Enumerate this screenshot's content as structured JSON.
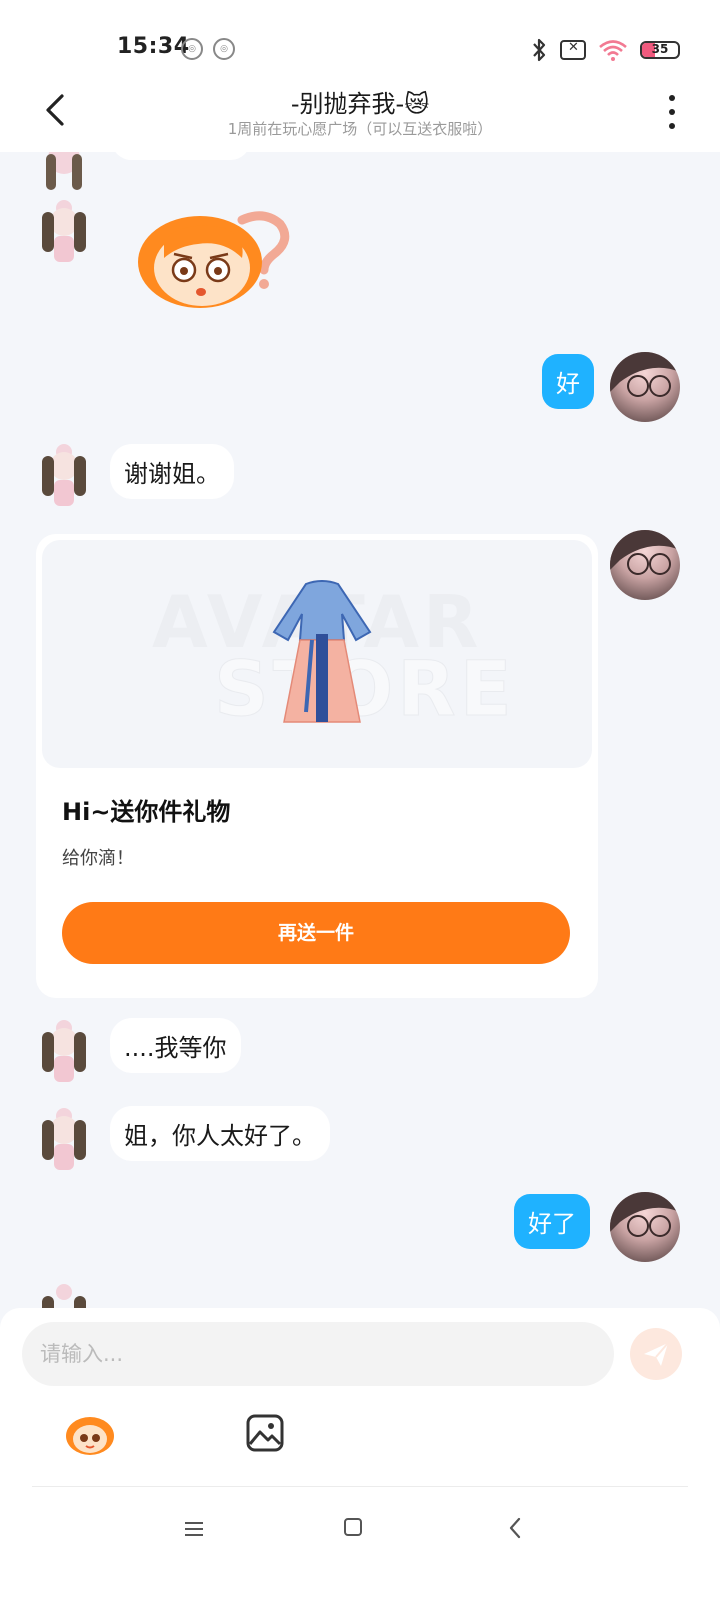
{
  "status_bar": {
    "time": "15:34",
    "notif_icon_1": "notification-icon",
    "notif_icon_2": "notification-icon",
    "battery_level": "35",
    "icons": [
      "bluetooth-icon",
      "no-sim-icon",
      "wifi-icon",
      "battery-icon"
    ],
    "battery_color": "#f05a7e"
  },
  "header": {
    "title": "-别抛弃我-",
    "title_emoji": "😿",
    "subtitle": "1周前在玩心愿广场（可以互送衣服啦）"
  },
  "messages": [
    {
      "side": "left",
      "type": "sticker",
      "sticker": "question-mark-sticker"
    },
    {
      "side": "right",
      "type": "text",
      "text": "好"
    },
    {
      "side": "left",
      "type": "text",
      "text": "谢谢姐。"
    },
    {
      "side": "right",
      "type": "gift",
      "gift": {
        "watermark_line1": "AVATAR",
        "watermark_line2": "STORE",
        "title": "Hi~送你件礼物",
        "message": "给你滴！",
        "button": "再送一件"
      }
    },
    {
      "side": "left",
      "type": "text",
      "text": "....我等你"
    },
    {
      "side": "left",
      "type": "text",
      "text": "姐，你人太好了。"
    },
    {
      "side": "right",
      "type": "text",
      "text": "好了"
    }
  ],
  "input": {
    "placeholder": "请输入..."
  },
  "colors": {
    "accent_blue": "#1fb2ff",
    "accent_orange": "#ff7a16",
    "background": "#f4f6fa"
  }
}
